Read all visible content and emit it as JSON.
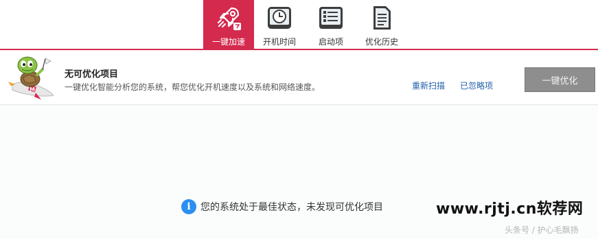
{
  "tabs": [
    {
      "label": "一键加速",
      "icon": "rocket-icon",
      "active": true
    },
    {
      "label": "开机时间",
      "icon": "clock-icon",
      "active": false
    },
    {
      "label": "启动项",
      "icon": "checklist-icon",
      "active": false
    },
    {
      "label": "优化历史",
      "icon": "document-icon",
      "active": false
    }
  ],
  "panel": {
    "mascot_icon": "turtle-rocket-mascot",
    "title": "无可优化项目",
    "description": "一键优化智能分析您的系统，帮您优化开机速度以及系统和网络速度。",
    "rescan_label": "重新扫描",
    "ignored_label": "已忽略项",
    "optimize_label": "一键优化"
  },
  "status": {
    "icon": "info-icon",
    "text": "您的系统处于最佳状态，未发现可优化项目"
  },
  "watermark": {
    "site": "www.rjtj.cn软荐网",
    "author": "头条号 / 护心毛飘扬"
  },
  "colors": {
    "accent": "#d42a4e",
    "link": "#1f5fa8",
    "button_disabled": "#8e8e8e",
    "info": "#2b8ff0"
  }
}
